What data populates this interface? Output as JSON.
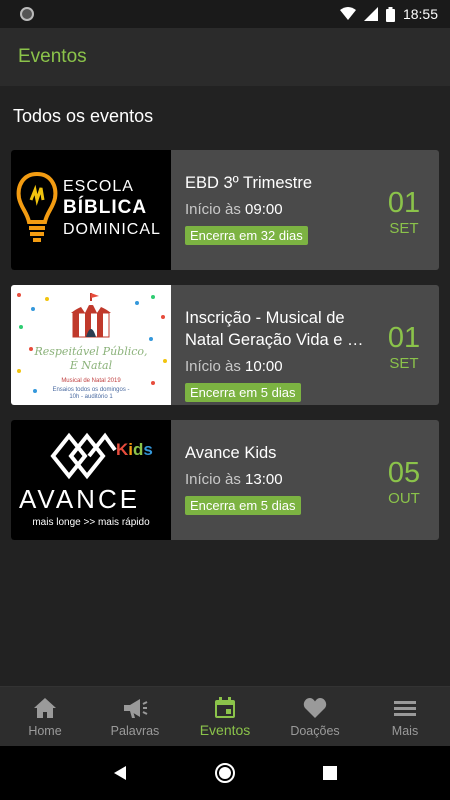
{
  "status_bar": {
    "time": "18:55"
  },
  "app_bar": {
    "title": "Eventos"
  },
  "section": {
    "title": "Todos os eventos"
  },
  "start_prefix": "Início às",
  "events": [
    {
      "title": "EBD 3º Trimestre",
      "start_time": "09:00",
      "badge": "Encerra em 32 dias",
      "day": "01",
      "month": "SET",
      "thumb_text": [
        "ESCOLA",
        "BÍBLICA",
        "DOMINICAL"
      ]
    },
    {
      "title": "Inscrição - Musical de Natal Geração Vida e …",
      "start_time": "10:00",
      "badge": "Encerra em 5 dias",
      "day": "01",
      "month": "SET",
      "thumb_text": [
        "Respeitável Público,",
        "É Natal",
        "Musical de Natal 2019",
        "Ensaios todos os domingos -",
        "10h - auditório 1"
      ]
    },
    {
      "title": "Avance Kids",
      "start_time": "13:00",
      "badge": "Encerra em 5 dias",
      "day": "05",
      "month": "OUT",
      "thumb_text": [
        "Kids",
        "AVANCE",
        "mais longe >> mais rápido"
      ]
    }
  ],
  "bottom_nav": [
    {
      "label": "Home",
      "icon": "home-icon",
      "active": false
    },
    {
      "label": "Palavras",
      "icon": "megaphone-icon",
      "active": false
    },
    {
      "label": "Eventos",
      "icon": "calendar-icon",
      "active": true
    },
    {
      "label": "Doações",
      "icon": "heart-icon",
      "active": false
    },
    {
      "label": "Mais",
      "icon": "menu-icon",
      "active": false
    }
  ],
  "colors": {
    "accent": "#8bc34a",
    "badge": "#7cb342",
    "card": "#4a4a4a",
    "background": "#222222"
  }
}
